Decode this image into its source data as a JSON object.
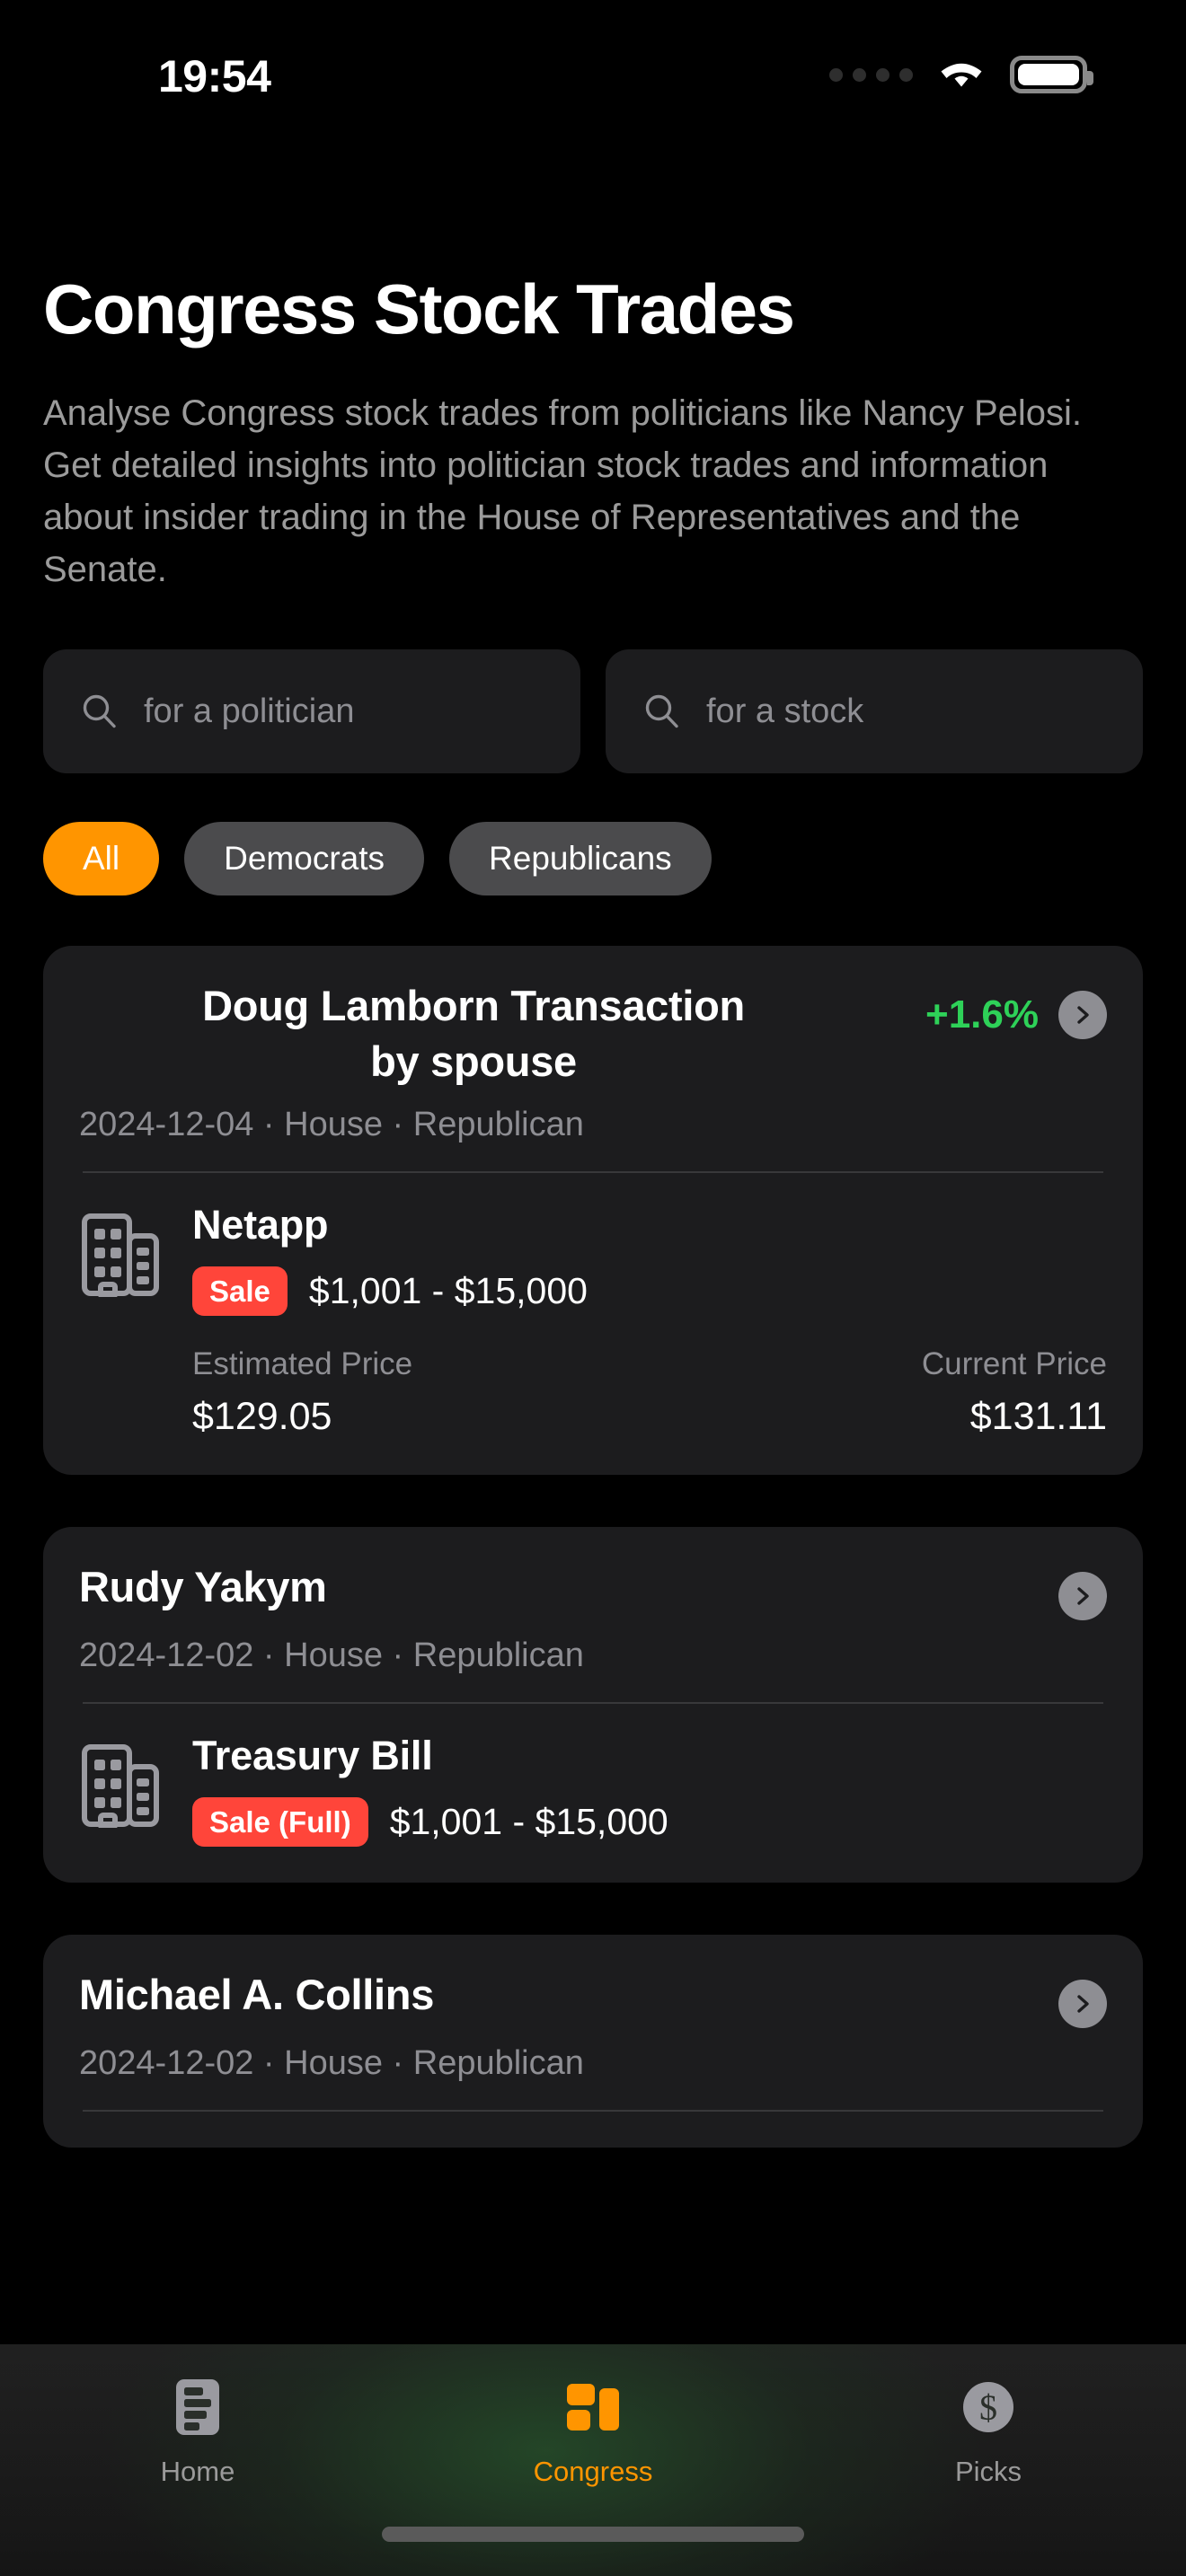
{
  "status_bar": {
    "time": "19:54",
    "cellular_icon": "signal-dots-icon",
    "wifi_icon": "wifi-icon",
    "battery_icon": "battery-full-icon"
  },
  "header": {
    "title": "Congress Stock Trades",
    "description": "Analyse Congress stock trades from politicians like Nancy Pelosi. Get detailed insights into politician stock trades and information about insider trading in the House of Representatives and the Senate."
  },
  "search": {
    "politician": {
      "placeholder": "for a politician",
      "value": "",
      "icon": "search-icon"
    },
    "stock": {
      "placeholder": "for a stock",
      "value": "",
      "icon": "search-icon"
    }
  },
  "filters": {
    "selected": "All",
    "options": [
      "All",
      "Democrats",
      "Republicans"
    ]
  },
  "colors": {
    "accent_orange": "#FF9500",
    "positive_green": "#2ED158",
    "sale_red": "#FF453A",
    "card_background": "#1c1c1e",
    "page_background": "#000000",
    "muted_text": "#8e8e93"
  },
  "cards": [
    {
      "name": "Doug Lamborn Transaction by spouse",
      "name_line1": "Doug Lamborn Transaction",
      "name_line2": "by spouse",
      "change_pct": "+1.6%",
      "change_direction": "positive",
      "meta": "2024-12-04 · House · Republican",
      "date": "2024-12-04",
      "chamber": "House",
      "party": "Republican",
      "holding": {
        "icon": "building-icon",
        "stock": "Netapp",
        "badge": "Sale",
        "amount_range": "$1,001 - $15,000",
        "estimated_price_label": "Estimated Price",
        "estimated_price": "$129.05",
        "current_price_label": "Current Price",
        "current_price": "$131.11"
      }
    },
    {
      "name": "Rudy Yakym",
      "change_pct": "",
      "meta": "2024-12-02 · House · Republican",
      "date": "2024-12-02",
      "chamber": "House",
      "party": "Republican",
      "holding": {
        "icon": "building-icon",
        "stock": "Treasury Bill",
        "badge": "Sale (Full)",
        "amount_range": "$1,001 - $15,000"
      }
    },
    {
      "name": "Michael A. Collins",
      "change_pct": "",
      "meta": "2024-12-02 · House · Republican",
      "date": "2024-12-02",
      "chamber": "House",
      "party": "Republican"
    }
  ],
  "tab_bar": {
    "active": "Congress",
    "tabs": [
      {
        "label": "Home",
        "icon": "home-list-icon",
        "active": false
      },
      {
        "label": "Congress",
        "icon": "congress-blocks-icon",
        "active": true
      },
      {
        "label": "Picks",
        "icon": "dollar-circle-icon",
        "active": false
      }
    ]
  }
}
